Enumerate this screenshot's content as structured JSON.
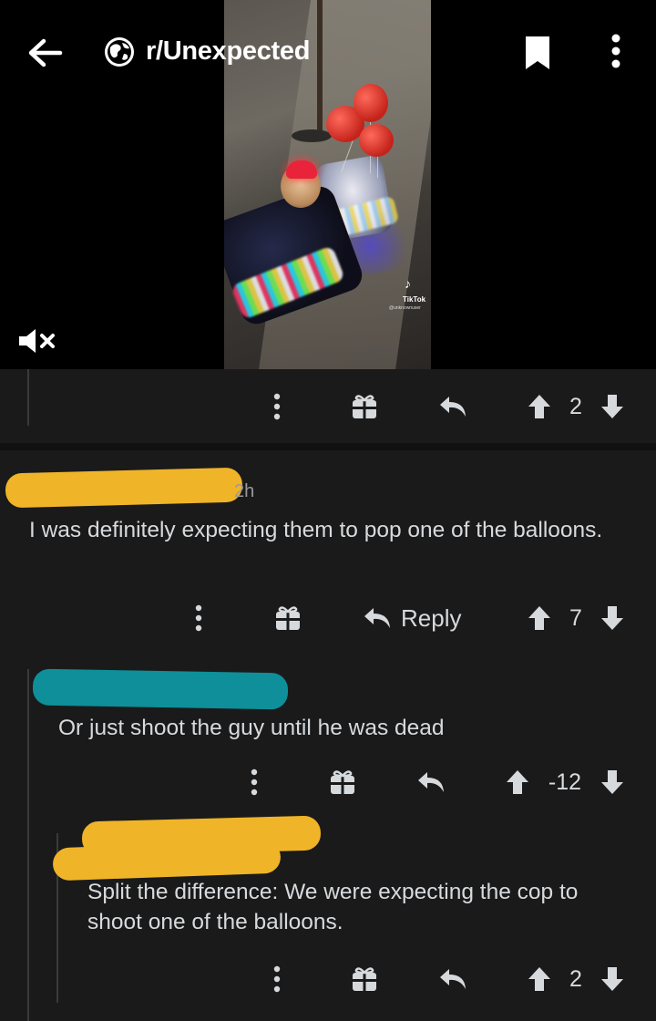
{
  "header": {
    "subreddit": "r/Unexpected",
    "icons": {
      "back": "back-arrow-icon",
      "subreddit": "subreddit-globe-icon",
      "save": "bookmark-icon",
      "more": "more-vertical-icon",
      "mute": "muted-speaker-icon"
    }
  },
  "video": {
    "watermark_brand": "TikTok",
    "watermark_handle": "@unknownuser"
  },
  "post_actions": {
    "score": "2"
  },
  "comments": [
    {
      "age": "2h",
      "text": "I was definitely expecting them to pop one of the balloons.",
      "reply_label": "Reply",
      "score": "7"
    },
    {
      "text": "Or just shoot the guy until he was dead",
      "score": "-12"
    },
    {
      "text": "Split the difference: We were expecting the cop to shoot one of the balloons.",
      "score": "2"
    }
  ],
  "colors": {
    "background": "#1a1a1b",
    "text": "#d7dadc",
    "redaction_yellow": "#f0b429",
    "redaction_teal": "#0e8f99"
  }
}
